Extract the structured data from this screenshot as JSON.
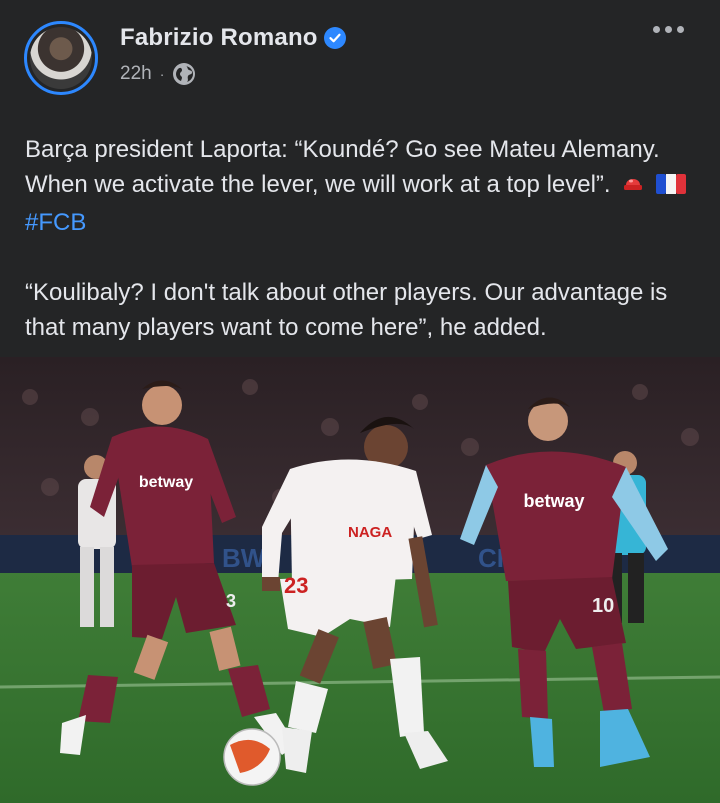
{
  "author": {
    "name": "Fabrizio Romano",
    "verified": true
  },
  "meta": {
    "time": "22h",
    "separator": "·",
    "audience_icon": "globe-icon"
  },
  "menu_icon": "more-icon",
  "post": {
    "paragraph1_text": "Barça president Laporta: “Koundé? Go see Mateu Alemany. When we activate the lever, we will work at a top level”.",
    "paragraph1_emoji": [
      "red-light-emoji",
      "france-flag-emoji"
    ],
    "hashtag": "#FCB",
    "paragraph2_text": "“Koulibaly? I don't talk about other players. Our advantage is that many players want to come here”, he added."
  },
  "photo": {
    "description_icon": "football-match-photo",
    "sponsor_text": "betway",
    "shirt_numbers": [
      "3",
      "23",
      "10"
    ],
    "board_text": [
      "BWI",
      "CHI"
    ]
  },
  "colors": {
    "background": "#242526",
    "text": "#e4e6eb",
    "secondary_text": "#b0b3b8",
    "accent": "#2d88ff",
    "hashtag": "#4599ff"
  }
}
